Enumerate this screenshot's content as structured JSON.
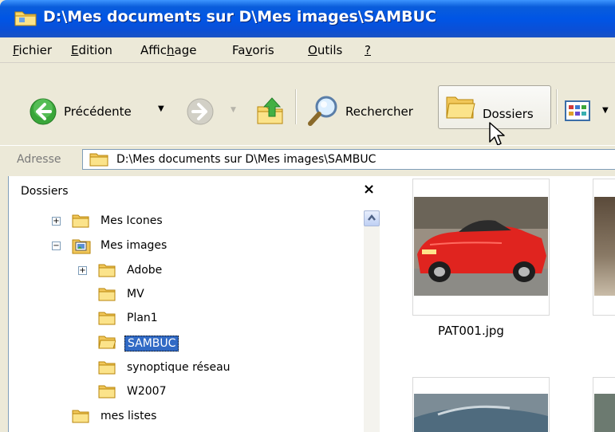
{
  "window": {
    "title": "D:\\Mes documents sur D\\Mes images\\SAMBUC"
  },
  "menu": [
    {
      "label": "Fichier",
      "u": "F",
      "rest": "ichier"
    },
    {
      "label": "Edition",
      "u": "E",
      "rest": "dition"
    },
    {
      "label": "Affichage",
      "pre": "Affic",
      "u": "h",
      "rest": "age"
    },
    {
      "label": "Favoris",
      "pre": "Fa",
      "u": "v",
      "rest": "oris"
    },
    {
      "label": "Outils",
      "u": "O",
      "rest": "utils"
    },
    {
      "label": "?",
      "u": "?",
      "rest": ""
    }
  ],
  "toolbar": {
    "back_label": "Précédente",
    "search_label": "Rechercher",
    "folders_label": "Dossiers"
  },
  "address": {
    "label": "Adresse",
    "value": "D:\\Mes documents sur D\\Mes images\\SAMBUC"
  },
  "folder_pane": {
    "title": "Dossiers",
    "close": "×",
    "items": [
      {
        "label": "Mes Icones",
        "expander": "+"
      },
      {
        "label": "Mes images",
        "expander": "−"
      },
      {
        "label": "Adobe",
        "expander": "+"
      },
      {
        "label": "MV"
      },
      {
        "label": "Plan1"
      },
      {
        "label": "SAMBUC",
        "selected": true
      },
      {
        "label": "synoptique réseau"
      },
      {
        "label": "W2007"
      },
      {
        "label": "mes listes"
      }
    ]
  },
  "thumbnails": [
    {
      "label": "PAT001.jpg"
    }
  ],
  "colors": {
    "title_bar": "#0055e5",
    "selection": "#316ac5"
  }
}
